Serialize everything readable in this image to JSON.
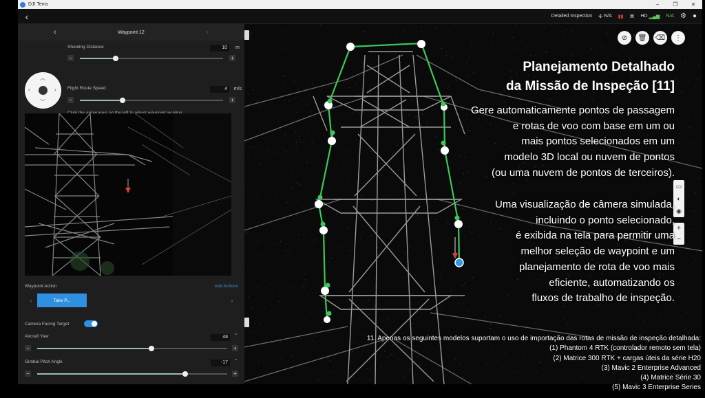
{
  "window": {
    "title": "DJI Terra",
    "controls": [
      "–",
      "❐",
      "✕"
    ]
  },
  "toolbar": {
    "back": "‹",
    "mode": "Detailed Inspection",
    "rtk": "N/A",
    "hd": "HD",
    "signal": "N/A"
  },
  "panel": {
    "waypoint_title": "Waypoint 12",
    "shooting_distance_label": "Shooting Distance",
    "shooting_distance_value": "10",
    "shooting_distance_unit": "m",
    "shooting_distance_fraction": 0.25,
    "flight_speed_label": "Flight Route Speed",
    "flight_speed_value": "4",
    "flight_speed_unit": "m/s",
    "flight_speed_fraction": 0.3,
    "hint": "Click the arrow keys on the left to adjust waypoint location",
    "waypoint_action_label": "Waypoint Action",
    "add_actions": "Add Actions",
    "action_button": "Take P...",
    "camera_facing_label": "Camera Facing Target",
    "camera_facing_on": true,
    "aircraft_yaw_label": "Aircraft Yaw",
    "aircraft_yaw_value": "48",
    "aircraft_yaw_unit": "°",
    "aircraft_yaw_fraction": 0.6,
    "gimbal_label": "Gimbal Pitch Angle",
    "gimbal_value": "-17",
    "gimbal_unit": "°",
    "gimbal_fraction": 0.78
  },
  "overlay": {
    "title_line1": "Planejamento Detalhado",
    "title_line2": "da Missão de Inspeção [11]",
    "p1": [
      "Gere automaticamente pontos de passagem",
      "e rotas de voo com base em um ou",
      "mais pontos selecionados em um",
      "modelo 3D local ou nuvem de pontos",
      "(ou uma nuvem de pontos de terceiros)."
    ],
    "p2": [
      "Uma visualização de câmera simulada,",
      "incluindo o ponto selecionado,",
      "é exibida na tela para permitir uma",
      "melhor seleção de waypoint e um",
      "planejamento de rota de voo mais",
      "eficiente, automatizando os",
      "fluxos de trabalho de inspeção."
    ],
    "footnote": [
      "11. Apenas os seguintes modelos suportam o uso de importação das rotas de missão de inspeção detalhada:",
      "(1) Phantom 4 RTK (controlador remoto sem tela)",
      "(2) Matrice 300 RTK + cargas úteis da série H20",
      "(3) Mavic 2 Enterprise Advanced",
      "(4) Matrice Série 30",
      "(5) Mavic 3 Enterprise Series"
    ]
  },
  "colors": {
    "accent": "#2f8fe0",
    "route": "#3cc85a",
    "waypoint": "#ffffff"
  }
}
